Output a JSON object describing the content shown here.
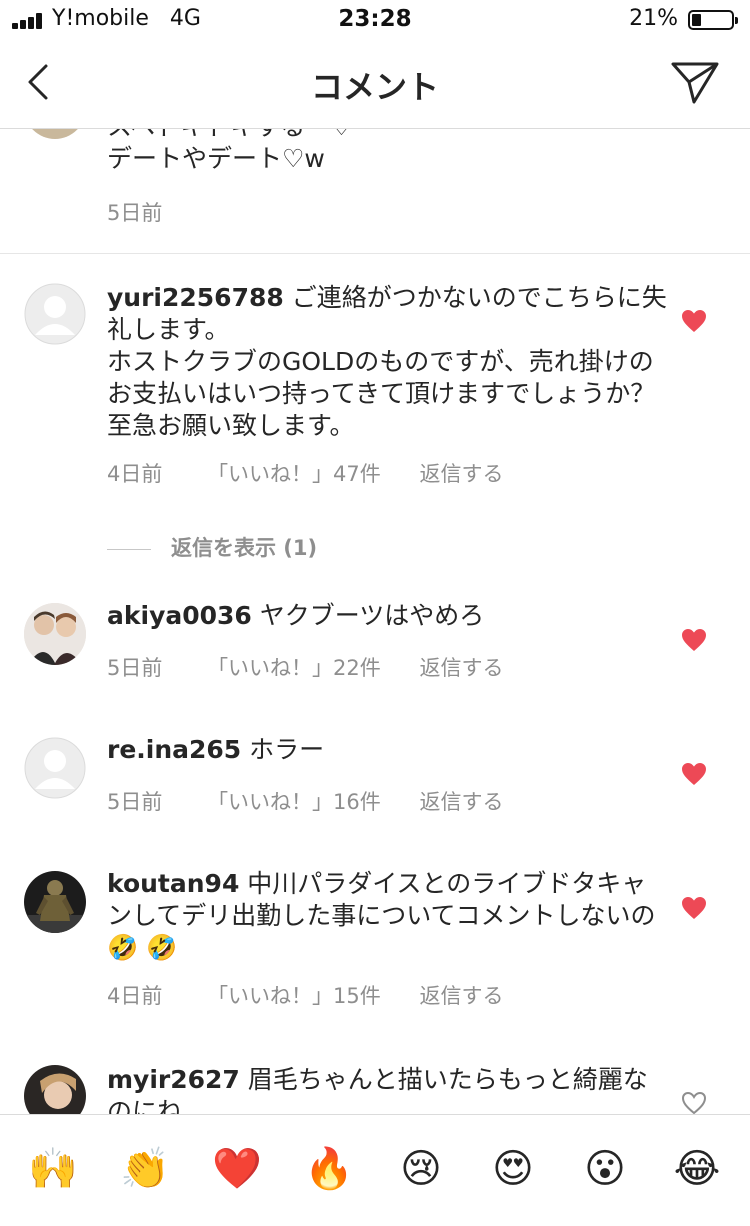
{
  "status_bar": {
    "carrier": "Y!mobile",
    "network": "4G",
    "time": "23:28",
    "battery": "21%"
  },
  "nav": {
    "title": "コメント"
  },
  "colors": {
    "like_red": "#ed4956",
    "meta_gray": "#8e8e8e",
    "text": "#262626"
  },
  "comments": [
    {
      "username": "",
      "lines": [
        "スペドキドキする〜♡",
        "デートやデート♡w"
      ],
      "time": "5日前",
      "liked": false
    },
    {
      "username": "yuri2256788",
      "text": "ご連絡がつかないのでこちらに失礼します。",
      "text2": "ホストクラブのGOLDのものですが、売れ掛けのお支払いはいつ持ってきて頂けますでしょうか？至急お願い致します。",
      "time": "4日前",
      "likes": "「いいね！」47件",
      "reply": "返信する",
      "view_replies": "返信を表示 (1)",
      "liked": true
    },
    {
      "username": "akiya0036",
      "text": "ヤクブーツはやめろ",
      "time": "5日前",
      "likes": "「いいね！」22件",
      "reply": "返信する",
      "liked": true
    },
    {
      "username": "re.ina265",
      "text": "ホラー",
      "time": "5日前",
      "likes": "「いいね！」16件",
      "reply": "返信する",
      "liked": true
    },
    {
      "username": "koutan94",
      "text": "中川パラダイスとのライブドタキャンしてデリ出勤した事についてコメントしないの🤣 🤣",
      "time": "4日前",
      "likes": "「いいね！」15件",
      "reply": "返信する",
      "liked": true
    },
    {
      "username": "myir2627",
      "text": "眉毛ちゃんと描いたらもっと綺麗なのにね",
      "liked": false
    }
  ],
  "emoji_bar": [
    "🙌",
    "👏",
    "❤️",
    "🔥",
    "😢",
    "😍",
    "😮",
    "😂"
  ]
}
